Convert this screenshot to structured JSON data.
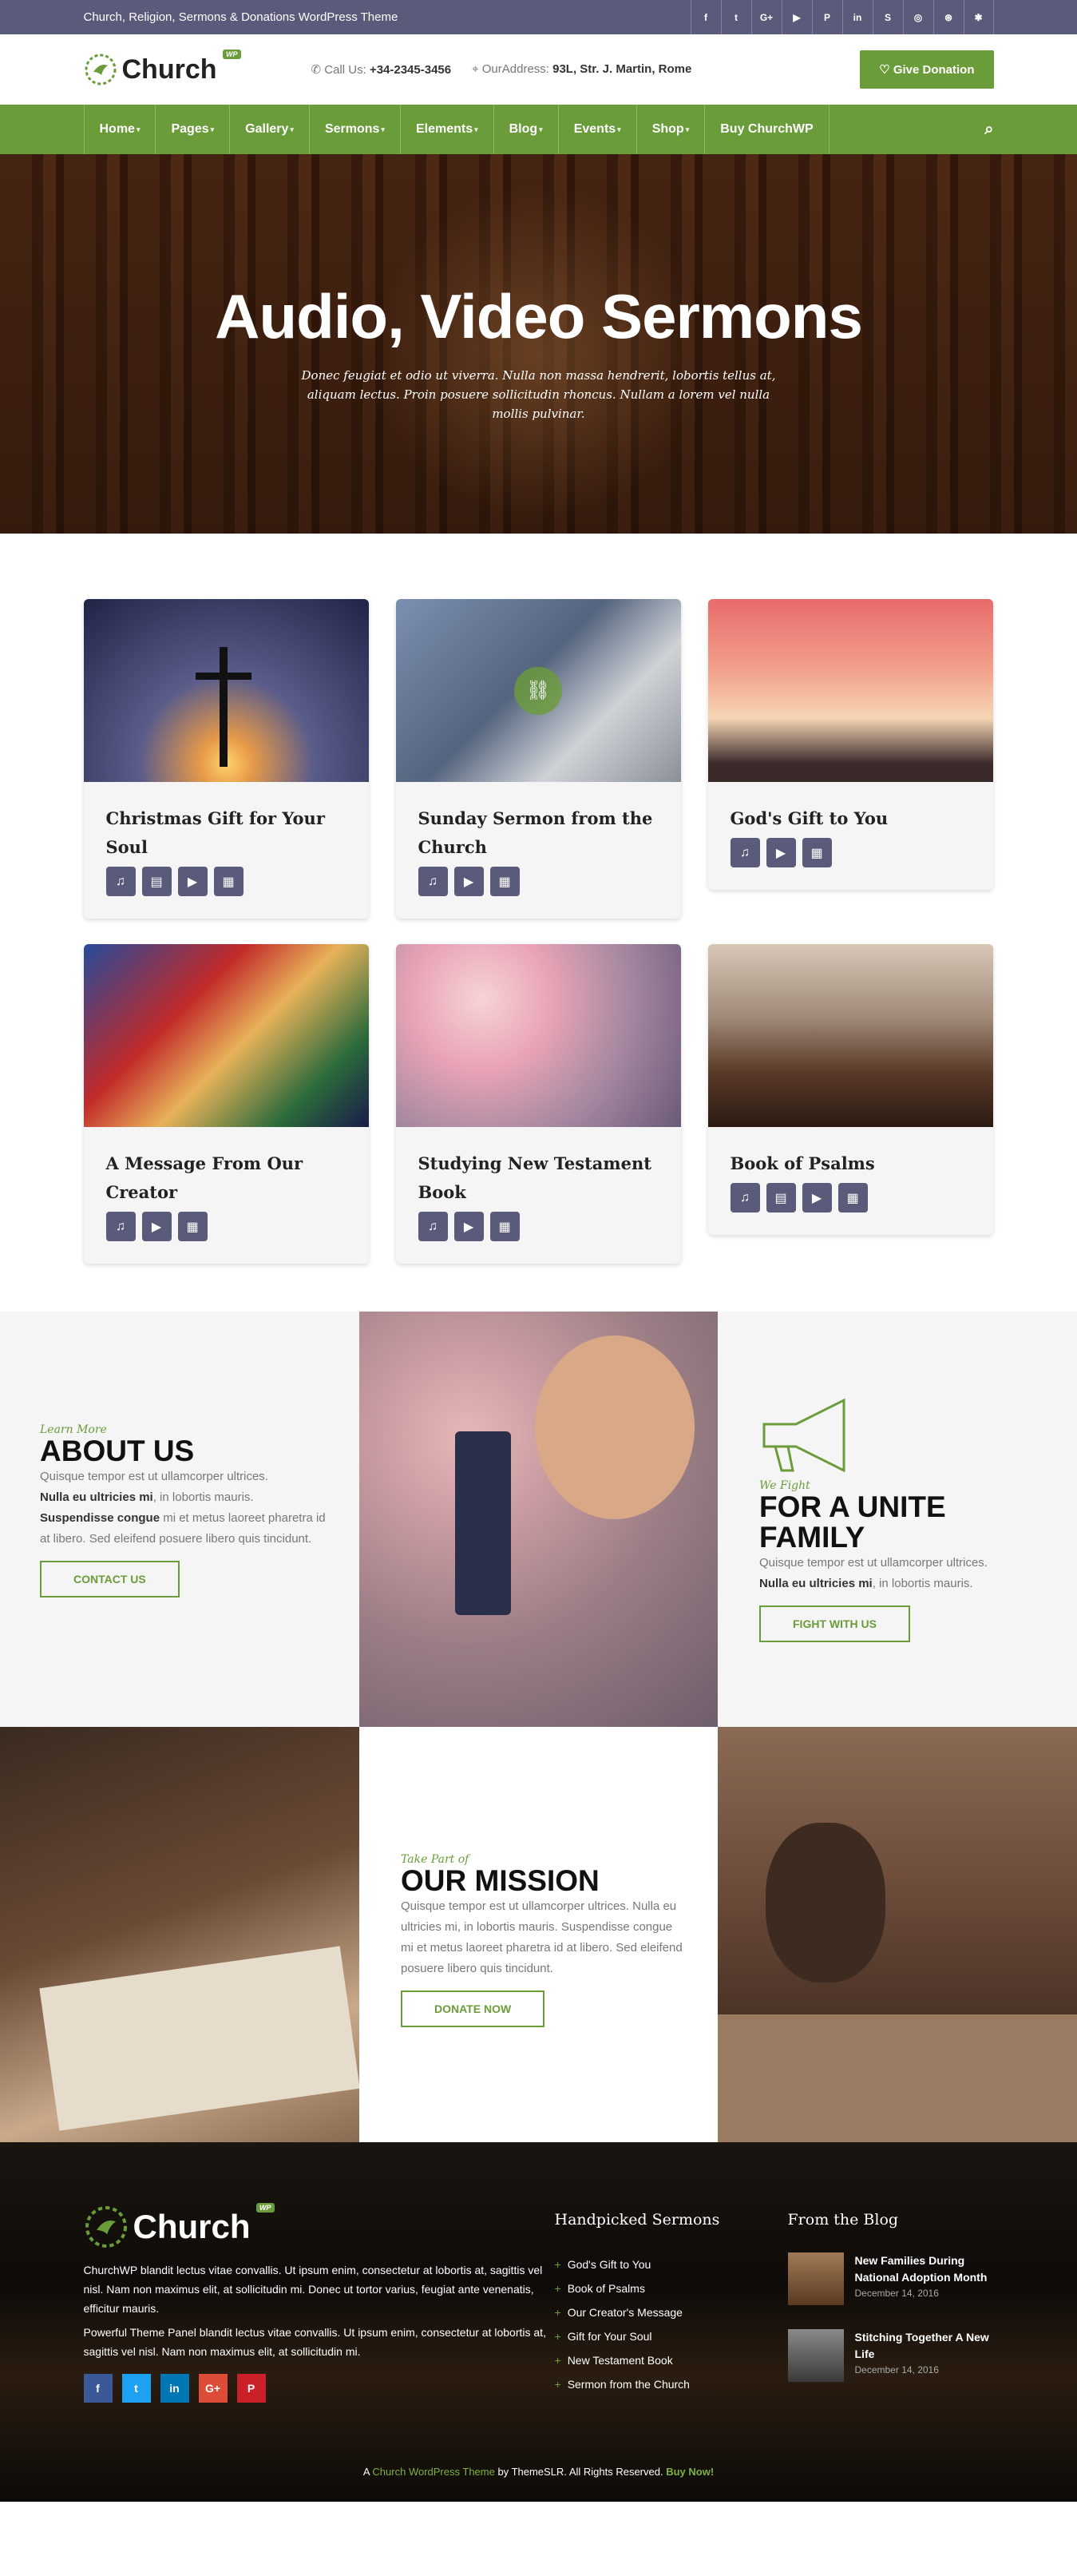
{
  "topbar": {
    "tagline": "Church, Religion, Sermons & Donations WordPress Theme",
    "social_icons": [
      {
        "icon": "facebook-icon",
        "glyph": "f"
      },
      {
        "icon": "twitter-icon",
        "glyph": "t"
      },
      {
        "icon": "google-plus-icon",
        "glyph": "G+"
      },
      {
        "icon": "youtube-icon",
        "glyph": "▶"
      },
      {
        "icon": "pinterest-icon",
        "glyph": "P"
      },
      {
        "icon": "linkedin-icon",
        "glyph": "in"
      },
      {
        "icon": "skype-icon",
        "glyph": "S"
      },
      {
        "icon": "instagram-icon",
        "glyph": "◎"
      },
      {
        "icon": "dribbble-icon",
        "glyph": "⊛"
      },
      {
        "icon": "yelp-icon",
        "glyph": "✱"
      }
    ]
  },
  "header": {
    "logo_text": "Church",
    "logo_badge": "WP",
    "call_label": "Call Us:",
    "call_number": "+34-2345-3456",
    "address_label": "OurAddress:",
    "address_value": "93L, Str. J. Martin, Rome",
    "donate_label": "Give Donation"
  },
  "nav": {
    "items": [
      "Home",
      "Pages",
      "Gallery",
      "Sermons",
      "Elements",
      "Blog",
      "Events",
      "Shop",
      "Buy ChurchWP"
    ]
  },
  "hero": {
    "title": "Audio, Video Sermons",
    "subtitle": "Donec feugiat et odio ut viverra. Nulla non massa hendrerit, lobortis tellus at, aliquam lectus. Proin posuere sollicitudin rhoncus. Nullam a lorem vel nulla mollis pulvinar."
  },
  "sermons": [
    {
      "title": "Christmas Gift for Your Soul",
      "icons": [
        "music-icon",
        "film-icon",
        "play-icon",
        "book-icon"
      ]
    },
    {
      "title": "Sunday Sermon from the Church",
      "icons": [
        "music-icon",
        "play-icon",
        "book-icon"
      ]
    },
    {
      "title": "God's Gift to You",
      "icons": [
        "music-icon",
        "play-icon",
        "book-icon"
      ]
    },
    {
      "title": "A Message From Our Creator",
      "icons": [
        "music-icon",
        "play-icon",
        "book-icon"
      ]
    },
    {
      "title": "Studying New Testament Book",
      "icons": [
        "music-icon",
        "play-icon",
        "book-icon"
      ]
    },
    {
      "title": "Book of Psalms",
      "icons": [
        "music-icon",
        "film-icon",
        "play-icon",
        "book-icon"
      ]
    }
  ],
  "about": {
    "eyebrow": "Learn More",
    "title": "ABOUT US",
    "text1": "Quisque tempor est ut ullamcorper ultrices.",
    "bold1": "Nulla eu ultricies mi",
    "text2": ", in lobortis mauris.",
    "bold2": "Suspendisse congue",
    "text3": " mi et metus laoreet pharetra id at libero. Sed eleifend posuere libero quis tincidunt.",
    "button": "CONTACT US"
  },
  "unite": {
    "eyebrow": "We Fight",
    "title": "FOR A UNITE FAMILY",
    "text1": "Quisque tempor est ut ullamcorper ultrices.",
    "bold1": "Nulla eu ultricies mi",
    "text2": ", in lobortis mauris.",
    "button": "FIGHT WITH US"
  },
  "mission": {
    "eyebrow": "Take Part of",
    "title": "OUR MISSION",
    "text": "Quisque tempor est ut ullamcorper ultrices. Nulla eu ultricies mi, in lobortis mauris. Suspendisse congue mi et metus laoreet pharetra id at libero. Sed eleifend posuere libero quis tincidunt.",
    "button": "DONATE NOW"
  },
  "footer": {
    "logo_text": "Church",
    "logo_badge": "WP",
    "para1": "ChurchWP blandit lectus vitae convallis. Ut ipsum enim, consectetur at lobortis at, sagittis vel nisl. Nam non maximus elit, at sollicitudin mi. Donec ut tortor varius, feugiat ante venenatis, efficitur mauris.",
    "para2": "Powerful Theme Panel blandit lectus vitae convallis. Ut ipsum enim, consectetur at lobortis at, sagittis vel nisl. Nam non maximus elit, at sollicitudin mi.",
    "socials": [
      {
        "icon": "facebook-icon",
        "glyph": "f",
        "color": "#3b5998"
      },
      {
        "icon": "twitter-icon",
        "glyph": "t",
        "color": "#1da1f2"
      },
      {
        "icon": "linkedin-icon",
        "glyph": "in",
        "color": "#0077b5"
      },
      {
        "icon": "google-plus-icon",
        "glyph": "G+",
        "color": "#dd4b39"
      },
      {
        "icon": "pinterest-icon",
        "glyph": "P",
        "color": "#cb2027"
      }
    ],
    "sermons_heading": "Handpicked Sermons",
    "sermon_links": [
      "God's Gift to You",
      "Book of Psalms",
      "Our Creator's Message",
      "Gift for Your Soul",
      "New Testament Book",
      "Sermon from the Church"
    ],
    "blog_heading": "From the Blog",
    "posts": [
      {
        "title": "New Families During National Adoption Month",
        "date": "December 14, 2016"
      },
      {
        "title": "Stitching Together A New Life",
        "date": "December 14, 2016"
      }
    ],
    "copy_a": "A ",
    "copy_theme": "Church WordPress Theme",
    "copy_by": " by ThemeSLR. All Rights Reserved. ",
    "copy_buy": "Buy Now!"
  },
  "colors": {
    "accent": "#6b9c3a",
    "slate": "#5a5a7a"
  }
}
